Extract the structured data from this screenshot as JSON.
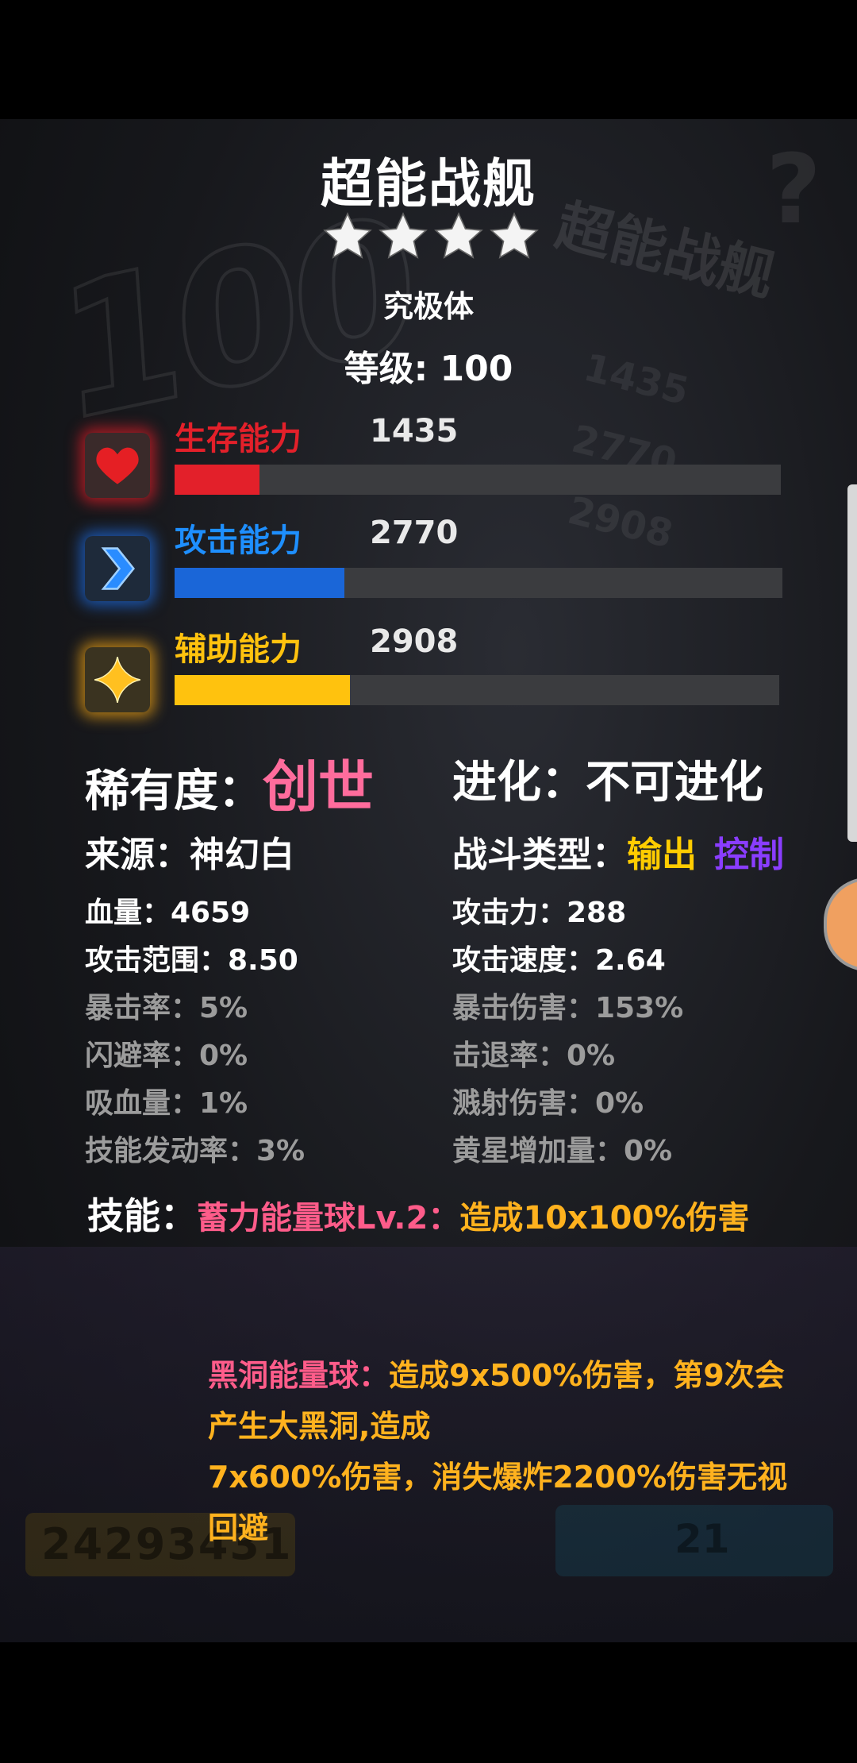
{
  "card": {
    "title": "超能战舰",
    "stars": 4,
    "form": "究极体",
    "level": "等级: 100"
  },
  "stats": [
    {
      "label": "生存能力",
      "value": "1435",
      "color": "#e3202a",
      "fill": 0.14,
      "icon": "heart-icon"
    },
    {
      "label": "攻击能力",
      "value": "2770",
      "color": "#1a66d8",
      "fill": 0.28,
      "icon": "chevron-right-icon"
    },
    {
      "label": "辅助能力",
      "value": "2908",
      "color": "#ffc20e",
      "fill": 0.29,
      "icon": "sparkle-icon"
    }
  ],
  "info": {
    "rarity_label": "稀有度：",
    "rarity_value": "创世",
    "evolution": "进化：不可进化",
    "source": "来源：神幻白",
    "battle_type_label": "战斗类型：",
    "battle_type_1": "输出",
    "battle_type_2": "控制",
    "hp": "血量：4659",
    "attack": "攻击力：288",
    "range": "攻击范围：8.50",
    "speed": "攻击速度：2.64",
    "crit_rate": "暴击率：5%",
    "crit_damage": "暴击伤害：153%",
    "dodge": "闪避率：0%",
    "knockback": "击退率：0%",
    "lifesteal": "吸血量：1%",
    "splash": "溅射伤害：0%",
    "skill_rate": "技能发动率：3%",
    "yellow_star": "黄星增加量：0%"
  },
  "skill": {
    "heading": "技能：",
    "name": "蓄力能量球Lv.2：",
    "effect": "造成10x100%伤害",
    "upgrade_name": "黑洞能量球：",
    "upgrade_effect_1": "造成9x500%伤害，第9次会产生大黑洞,造成",
    "upgrade_effect_2": "7x600%伤害，消失爆炸2200%伤害无视回避"
  },
  "background": {
    "big_number": "100",
    "ghost_title": "超能战舰",
    "ghost_values": [
      "1435",
      "2770",
      "2908"
    ],
    "score": "24293431",
    "badge": "21",
    "question_mark": "?"
  }
}
